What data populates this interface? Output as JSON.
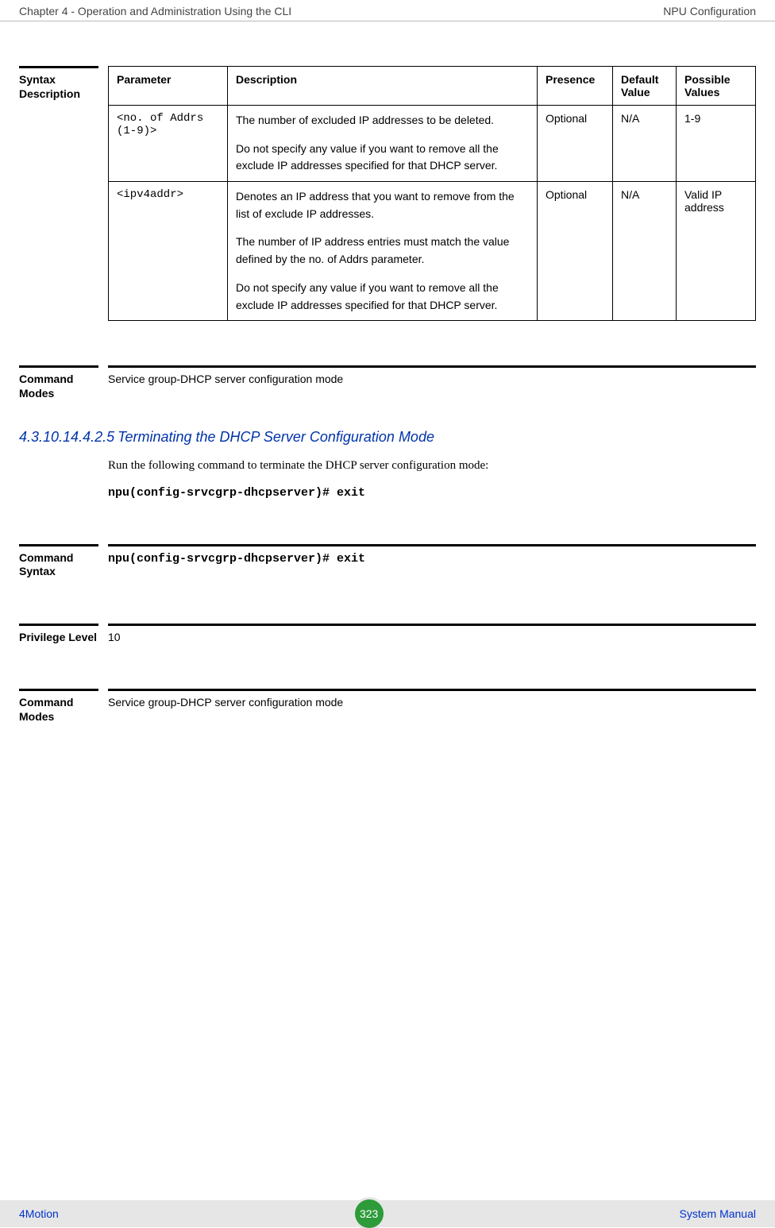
{
  "header": {
    "left": "Chapter 4 - Operation and Administration Using the CLI",
    "right": "NPU Configuration"
  },
  "syntax_description": {
    "label": "Syntax Description",
    "columns": {
      "parameter": "Parameter",
      "description": "Description",
      "presence": "Presence",
      "default": "Default Value",
      "possible": "Possible Values"
    },
    "rows": [
      {
        "parameter": "<no. of Addrs (1-9)>",
        "desc1": "The number of excluded  IP addresses to be deleted.",
        "desc2": "Do not specify any value if you want to remove all the exclude IP addresses specified for that DHCP server.",
        "presence": "Optional",
        "default": "N/A",
        "possible": "1-9"
      },
      {
        "parameter": "<ipv4addr>",
        "desc1": "Denotes an IP address that you want to remove from the list of exclude IP addresses.",
        "desc2": "The number of IP address entries must match the value defined by the no. of Addrs parameter.",
        "desc3": "Do not specify any value if you want to remove all the exclude IP addresses specified for that DHCP server.",
        "presence": "Optional",
        "default": "N/A",
        "possible": "Valid IP address"
      }
    ]
  },
  "command_modes1": {
    "label": "Command Modes",
    "text": "Service group-DHCP server configuration mode"
  },
  "heading": {
    "num": "4.3.10.14.4.2.5",
    "text": "Terminating the DHCP Server Configuration Mode"
  },
  "body": {
    "para": "Run the following command to terminate the DHCP server configuration mode:",
    "code": "npu(config-srvcgrp-dhcpserver)# exit"
  },
  "command_syntax": {
    "label": "Command Syntax",
    "text": "npu(config-srvcgrp-dhcpserver)# exit"
  },
  "privilege_level": {
    "label": "Privilege Level",
    "text": "10"
  },
  "command_modes2": {
    "label": "Command Modes",
    "text": "Service group-DHCP server configuration mode"
  },
  "footer": {
    "left": "4Motion",
    "page": "323",
    "right": "System Manual"
  }
}
